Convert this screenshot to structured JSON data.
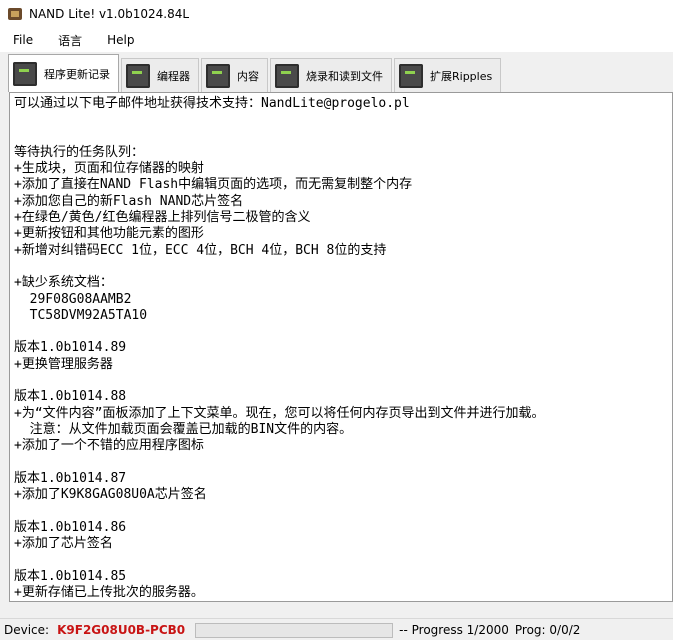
{
  "window": {
    "title": "NAND Lite! v1.0b1024.84L"
  },
  "menu": [
    "File",
    "语言",
    "Help"
  ],
  "tabs": [
    {
      "label": "程序更新记录",
      "active": true
    },
    {
      "label": "编程器",
      "active": false
    },
    {
      "label": "内容",
      "active": false
    },
    {
      "label": "烧录和读到文件",
      "active": false
    },
    {
      "label": "扩展Ripples",
      "active": false
    }
  ],
  "log": [
    "可以通过以下电子邮件地址获得技术支持：NandLite@progelo.pl",
    "",
    "",
    "等待执行的任务队列：",
    "+生成块，页面和位存储器的映射",
    "+添加了直接在NAND Flash中编辑页面的选项，而无需复制整个内存",
    "+添加您自己的新Flash NAND芯片签名",
    "+在绿色/黄色/红色编程器上排列信号二极管的含义",
    "+更新按钮和其他功能元素的图形",
    "+新增对纠错码ECC 1位，ECC 4位，BCH 4位，BCH 8位的支持",
    "",
    "+缺少系统文档：",
    "  29F08G08AAMB2",
    "  TC58DVM92A5TA10",
    "",
    "版本1.0b1014.89",
    "+更换管理服务器",
    "",
    "版本1.0b1014.88",
    "+为“文件内容”面板添加了上下文菜单。现在，您可以将任何内存页导出到文件并进行加载。",
    "  注意：从文件加载页面会覆盖已加载的BIN文件的内容。",
    "+添加了一个不错的应用程序图标",
    "",
    "版本1.0b1014.87",
    "+添加了K9K8GAG08U0A芯片签名",
    "",
    "版本1.0b1014.86",
    "+添加了芯片签名",
    "",
    "版本1.0b1014.85",
    "+更新存储已上传批次的服务器。"
  ],
  "status": {
    "device_label": "Device:",
    "device_value": "K9F2G08U0B-PCB0",
    "progress_fraction": 0.0,
    "progress_text": "-- Progress 1/2000",
    "prog_text": "Prog: 0/0/2"
  },
  "colors": {
    "device": "#c81414",
    "progress": "#06b025"
  }
}
